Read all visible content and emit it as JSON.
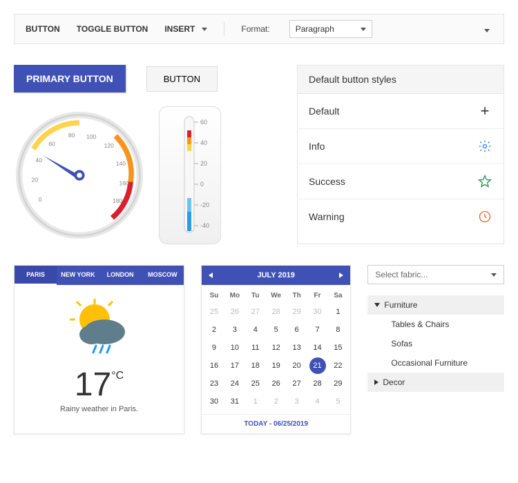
{
  "toolbar": {
    "button": "BUTTON",
    "toggle": "TOGGLE BUTTON",
    "insert": "INSERT",
    "format_label": "Format:",
    "format_value": "Paragraph"
  },
  "buttons": {
    "primary": "PRIMARY BUTTON",
    "secondary": "BUTTON"
  },
  "gauge": {
    "ticks": [
      "0",
      "20",
      "40",
      "60",
      "80",
      "100",
      "120",
      "140",
      "160",
      "180"
    ]
  },
  "thermo": {
    "ticks": [
      "60",
      "40",
      "20",
      "0",
      "-20",
      "-40"
    ]
  },
  "panel": {
    "header": "Default button styles",
    "rows": [
      {
        "label": "Default",
        "icon": "plus"
      },
      {
        "label": "Info",
        "icon": "gear"
      },
      {
        "label": "Success",
        "icon": "star"
      },
      {
        "label": "Warning",
        "icon": "clock"
      }
    ]
  },
  "weather": {
    "tabs": [
      "PARIS",
      "NEW YORK",
      "LONDON",
      "MOSCOW"
    ],
    "active_tab": 0,
    "temp": "17",
    "unit": "°C",
    "caption": "Rainy weather in Paris."
  },
  "calendar": {
    "title": "JULY 2019",
    "dow": [
      "Su",
      "Mo",
      "Tu",
      "We",
      "Th",
      "Fr",
      "Sa"
    ],
    "leading": [
      25,
      26,
      27,
      28,
      29,
      30,
      1
    ],
    "rows": [
      [
        2,
        3,
        4,
        5,
        6,
        7,
        8
      ],
      [
        9,
        10,
        11,
        12,
        13,
        14,
        15
      ],
      [
        16,
        17,
        18,
        19,
        20,
        21,
        22
      ],
      [
        23,
        24,
        25,
        26,
        27,
        28,
        29
      ],
      [
        30,
        31,
        1,
        2,
        3,
        4,
        5
      ]
    ],
    "selected": 21,
    "footer": "TODAY - 06/25/2019"
  },
  "combo": {
    "placeholder": "Select fabric..."
  },
  "tree": [
    {
      "label": "Furniture",
      "level": 0,
      "expanded": true
    },
    {
      "label": "Tables & Chairs",
      "level": 1
    },
    {
      "label": "Sofas",
      "level": 1
    },
    {
      "label": "Occasional Furniture",
      "level": 1
    },
    {
      "label": "Decor",
      "level": 0,
      "expanded": false
    }
  ]
}
